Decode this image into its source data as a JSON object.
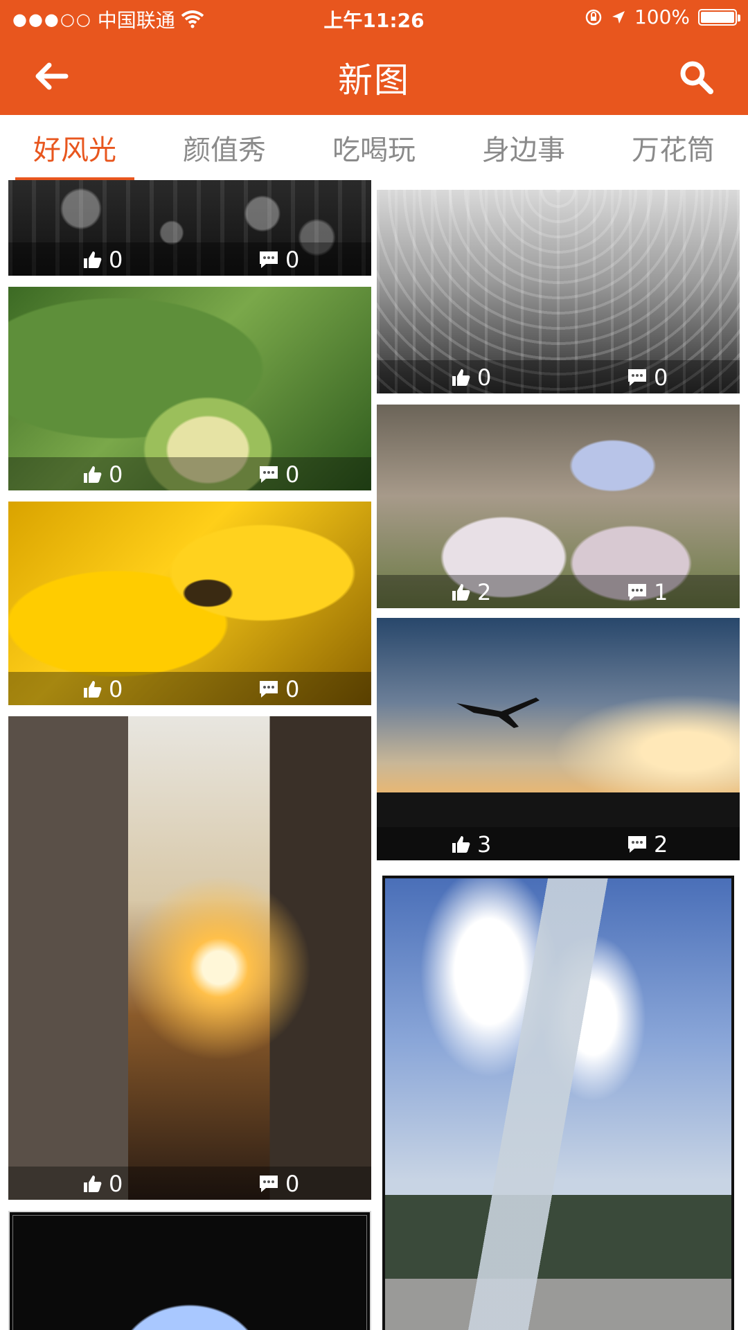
{
  "status_bar": {
    "signal_dots": "●●●○○",
    "carrier": "中国联通",
    "wifi_icon": "wifi-icon",
    "time": "上午11:26",
    "battery_percent": "100%",
    "battery_level": 1.0
  },
  "header": {
    "back_icon": "back-arrow-icon",
    "title": "新图",
    "search_icon": "search-icon",
    "accent_color": "#e8561e"
  },
  "tabs": [
    {
      "label": "好风光",
      "active": true
    },
    {
      "label": "颜值秀",
      "active": false
    },
    {
      "label": "吃喝玩",
      "active": false
    },
    {
      "label": "身边事",
      "active": false
    },
    {
      "label": "万花筒",
      "active": false
    }
  ],
  "feed": {
    "left_column": [
      {
        "subject": "wine glasses",
        "likes": "0",
        "comments": "0"
      },
      {
        "subject": "ant on flower bud",
        "likes": "0",
        "comments": "0"
      },
      {
        "subject": "insect on yellow flower",
        "likes": "0",
        "comments": "0"
      },
      {
        "subject": "sunset city street",
        "likes": "0",
        "comments": "0"
      },
      {
        "subject": "arched window",
        "likes": "",
        "comments": ""
      }
    ],
    "right_column": [
      {
        "subject": "rows of wine glasses",
        "likes": "0",
        "comments": "0"
      },
      {
        "subject": "butterfly on flowers",
        "likes": "2",
        "comments": "1"
      },
      {
        "subject": "airplane over fence",
        "likes": "3",
        "comments": "2"
      },
      {
        "subject": "glass tower and skyscrapers",
        "likes": "",
        "comments": ""
      }
    ]
  }
}
